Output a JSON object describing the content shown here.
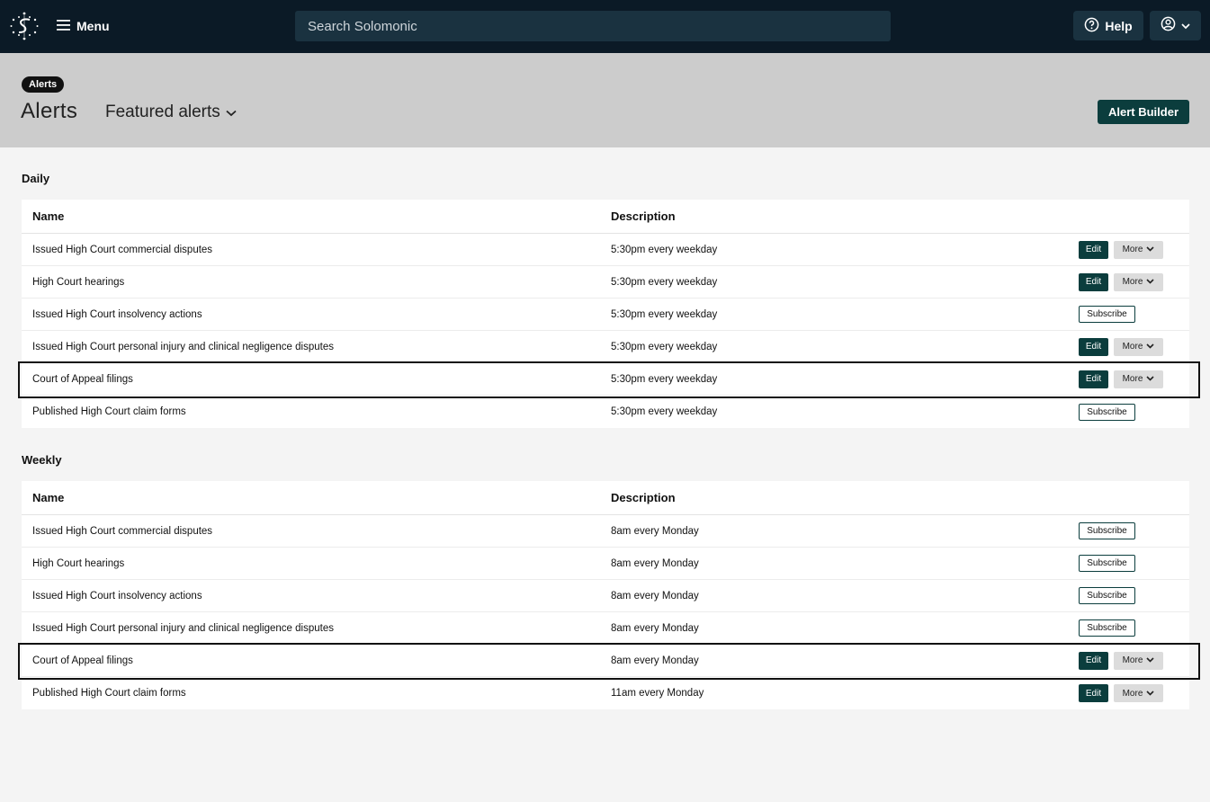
{
  "nav": {
    "menu_label": "Menu",
    "search_placeholder": "Search Solomonic",
    "help_label": "Help"
  },
  "header": {
    "breadcrumb": "Alerts",
    "title": "Alerts",
    "view_selector": "Featured alerts",
    "alert_builder_label": "Alert Builder"
  },
  "columns": {
    "name": "Name",
    "description": "Description"
  },
  "buttons": {
    "edit": "Edit",
    "more": "More",
    "subscribe": "Subscribe"
  },
  "sections": [
    {
      "title": "Daily",
      "rows": [
        {
          "name": "Issued High Court commercial disputes",
          "description": "5:30pm every weekday",
          "action": "edit",
          "highlighted": false
        },
        {
          "name": "High Court hearings",
          "description": "5:30pm every weekday",
          "action": "edit",
          "highlighted": false
        },
        {
          "name": "Issued High Court insolvency actions",
          "description": "5:30pm every weekday",
          "action": "subscribe",
          "highlighted": false
        },
        {
          "name": "Issued High Court personal injury and clinical negligence disputes",
          "description": "5:30pm every weekday",
          "action": "edit",
          "highlighted": false
        },
        {
          "name": "Court of Appeal filings",
          "description": "5:30pm every weekday",
          "action": "edit",
          "highlighted": true
        },
        {
          "name": "Published High Court claim forms",
          "description": "5:30pm every weekday",
          "action": "subscribe",
          "highlighted": false
        }
      ]
    },
    {
      "title": "Weekly",
      "rows": [
        {
          "name": "Issued High Court commercial disputes",
          "description": "8am every Monday",
          "action": "subscribe",
          "highlighted": false
        },
        {
          "name": "High Court hearings",
          "description": "8am every Monday",
          "action": "subscribe",
          "highlighted": false
        },
        {
          "name": "Issued High Court insolvency actions",
          "description": "8am every Monday",
          "action": "subscribe",
          "highlighted": false
        },
        {
          "name": "Issued High Court personal injury and clinical negligence disputes",
          "description": "8am every Monday",
          "action": "subscribe",
          "highlighted": false
        },
        {
          "name": "Court of Appeal filings",
          "description": "8am every Monday",
          "action": "edit",
          "highlighted": true
        },
        {
          "name": "Published High Court claim forms",
          "description": "11am every Monday",
          "action": "edit",
          "highlighted": false
        }
      ]
    }
  ],
  "colors": {
    "nav_bg": "#0b1a26",
    "header_bg": "#cccccc",
    "primary": "#0b3d3d"
  }
}
